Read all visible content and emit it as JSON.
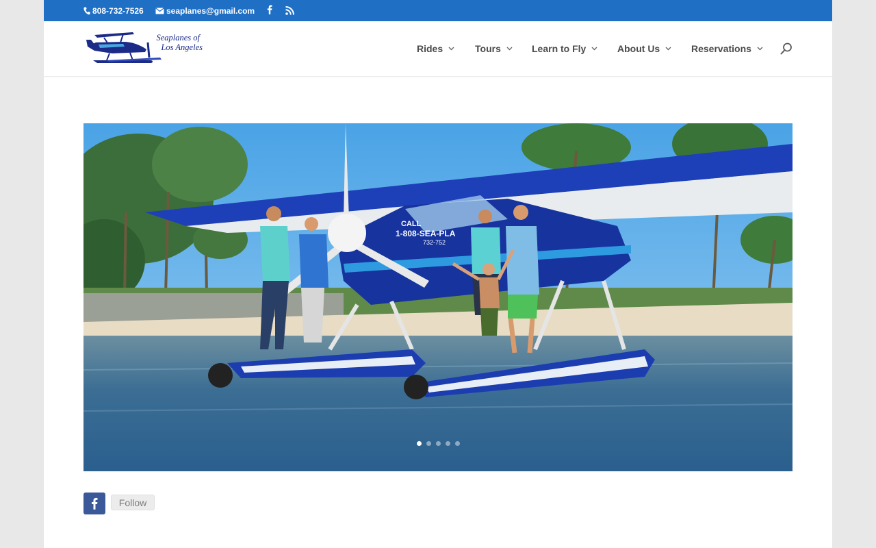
{
  "topbar": {
    "phone": "808-732-7526",
    "email": "seaplanes@gmail.com",
    "icons": [
      "phone-icon",
      "mail-icon",
      "facebook-icon",
      "rss-icon"
    ],
    "background": "#1f6fc4"
  },
  "brand": {
    "line1": "Seaplanes of",
    "line2": "Los Angeles",
    "color": "#1b2b87"
  },
  "nav": {
    "items": [
      {
        "label": "Rides"
      },
      {
        "label": "Tours"
      },
      {
        "label": "Learn to Fly"
      },
      {
        "label": "About Us"
      },
      {
        "label": "Reservations"
      }
    ],
    "search_icon": "search-icon"
  },
  "hero": {
    "slides": 5,
    "active_slide": 1,
    "plane_text": [
      "CALL",
      "1-808-SEA-PLA",
      "732-752"
    ]
  },
  "social": {
    "network_icon": "facebook-icon",
    "follow_label": "Follow",
    "fb_color": "#3b5998"
  }
}
